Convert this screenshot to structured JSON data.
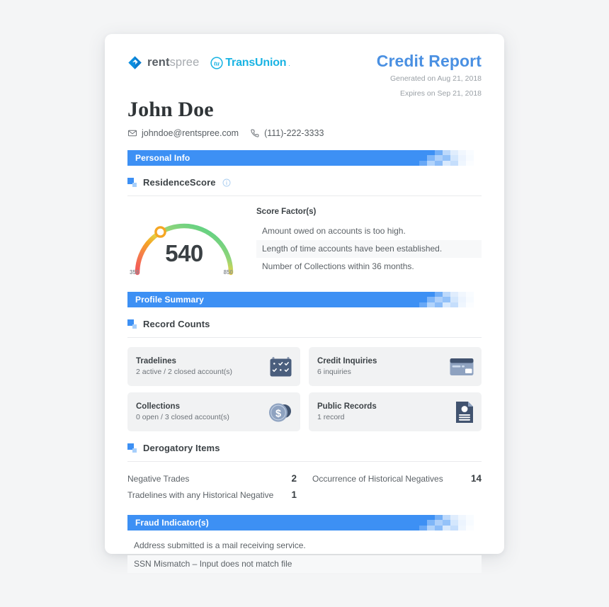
{
  "brand": {
    "rentspree_bold": "rent",
    "rentspree_light": "spree",
    "rentspree_icon": "rentspree-diamond-logo",
    "transunion_word": "TransUnion",
    "transunion_icon": "transunion-tu-circle-logo",
    "transunion_dot": "."
  },
  "header": {
    "title": "Credit Report",
    "generated": "Generated on Aug 21, 2018",
    "expires": "Expires on Sep 21, 2018",
    "accent": "#4a90e2"
  },
  "person": {
    "name": "John Doe",
    "email": "johndoe@rentspree.com",
    "phone": "(111)-222-3333",
    "email_icon": "envelope-icon",
    "phone_icon": "phone-icon"
  },
  "sections": {
    "personal_info": "Personal Info",
    "profile_summary": "Profile Summary",
    "fraud": "Fraud Indicator(s)",
    "bar_color": "#3d90f4"
  },
  "residence_score": {
    "heading": "ResidenceScore",
    "info_icon": "info-circle-icon",
    "score": "540",
    "min": "350",
    "max": "850",
    "factors_title": "Score Factor(s)",
    "factors": [
      "Amount owed on accounts is too high.",
      "Length of time accounts have been established.",
      "Number of Collections within 36 months."
    ]
  },
  "record_counts": {
    "heading": "Record Counts",
    "cards": [
      {
        "title": "Tradelines",
        "sub": "2 active / 2 closed account(s)",
        "icon": "calendar-check-icon"
      },
      {
        "title": "Credit Inquiries",
        "sub": "6 inquiries",
        "icon": "credit-card-icon"
      },
      {
        "title": "Collections",
        "sub": "0 open / 3 closed account(s)",
        "icon": "coins-dollar-icon"
      },
      {
        "title": "Public Records",
        "sub": "1 record",
        "icon": "document-id-icon"
      }
    ]
  },
  "derogatory": {
    "heading": "Derogatory Items",
    "rows": [
      {
        "label": "Negative Trades",
        "value": "2"
      },
      {
        "label": "Occurrence of Historical Negatives",
        "value": "14"
      },
      {
        "label": "Tradelines with any Historical Negative",
        "value": "1"
      }
    ]
  },
  "fraud_indicators": [
    "Address submitted is a mail receiving service.",
    "SSN Mismatch – Input does not match file"
  ],
  "chart_data": {
    "type": "gauge",
    "title": "ResidenceScore",
    "value": 540,
    "min": 350,
    "max": 850,
    "fraction": 0.38,
    "gradient": [
      "#f2545b",
      "#f5a623",
      "#f7d84a",
      "#5fd18c",
      "#3fcf7f"
    ],
    "marker_color": "#f5a623"
  }
}
